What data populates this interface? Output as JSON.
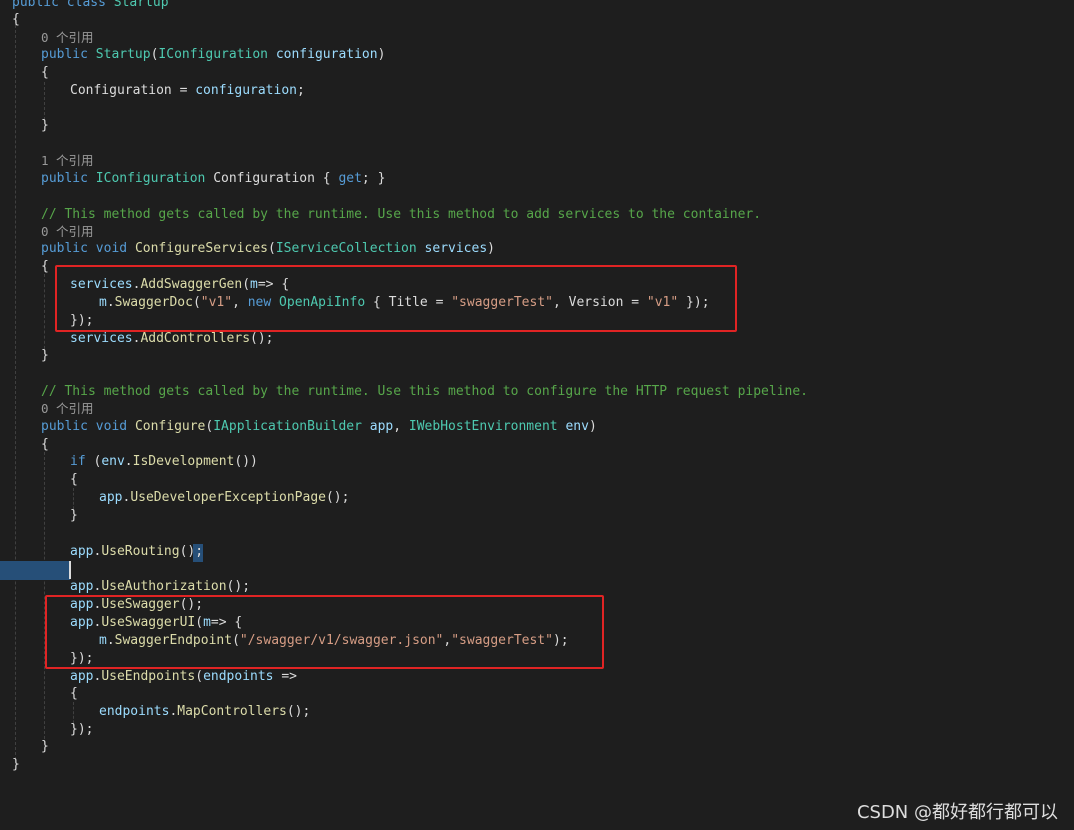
{
  "code": {
    "class_decl": [
      "public",
      " class ",
      "Startup"
    ],
    "open_brace_class": "{",
    "lens_ctor": "0 个引用",
    "ctor_line": [
      "public",
      " ",
      "Startup",
      "(",
      "IConfiguration",
      " ",
      "configuration",
      ")"
    ],
    "ctor_open": "{",
    "ctor_body": [
      "Configuration",
      " = ",
      "configuration",
      ";"
    ],
    "ctor_close": "}",
    "lens_prop": "1 个引用",
    "prop_line": [
      "public",
      " ",
      "IConfiguration",
      " Configuration { ",
      "get",
      "; }"
    ],
    "comment_1": "// This method gets called by the runtime. Use this method to add services to the container.",
    "lens_cs": "0 个引用",
    "cs_line": [
      "public",
      " ",
      "void",
      " ",
      "ConfigureServices",
      "(",
      "IServiceCollection",
      " ",
      "services",
      ")"
    ],
    "cs_open": "{",
    "cs_swag_1": [
      "services",
      ".",
      "AddSwaggerGen",
      "(",
      "m",
      "=> {"
    ],
    "cs_swag_2": [
      "m",
      ".",
      "SwaggerDoc",
      "(",
      "\"v1\"",
      ", ",
      "new",
      " ",
      "OpenApiInfo",
      " { Title = ",
      "\"swaggerTest\"",
      ", Version = ",
      "\"v1\"",
      " });"
    ],
    "cs_swag_3": "});",
    "cs_controllers": [
      "services",
      ".",
      "AddControllers",
      "();"
    ],
    "cs_close": "}",
    "comment_2": "// This method gets called by the runtime. Use this method to configure the HTTP request pipeline.",
    "lens_cfg": "0 个引用",
    "cfg_line": [
      "public",
      " ",
      "void",
      " ",
      "Configure",
      "(",
      "IApplicationBuilder",
      " ",
      "app",
      ", ",
      "IWebHostEnvironment",
      " ",
      "env",
      ")"
    ],
    "cfg_open": "{",
    "if_line": [
      "if",
      " (",
      "env",
      ".",
      "IsDevelopment",
      "())"
    ],
    "if_open": "{",
    "dev_page": [
      "app",
      ".",
      "UseDeveloperExceptionPage",
      "();"
    ],
    "if_close": "}",
    "use_routing": [
      "app",
      ".",
      "UseRouting",
      "();"
    ],
    "use_auth": [
      "app",
      ".",
      "UseAuthorization",
      "();"
    ],
    "use_swagger": [
      "app",
      ".",
      "UseSwagger",
      "();"
    ],
    "use_swagger_ui": [
      "app",
      ".",
      "UseSwaggerUI",
      "(",
      "m",
      "=> {"
    ],
    "swagger_endpoint": [
      "m",
      ".",
      "SwaggerEndpoint",
      "(",
      "\"/swagger/v1/swagger.json\"",
      ",",
      "\"swaggerTest\"",
      ");"
    ],
    "swagger_ui_close": "});",
    "use_endpoints": [
      "app",
      ".",
      "UseEndpoints",
      "(",
      "endpoints",
      " =>"
    ],
    "ep_open": "{",
    "map_controllers": [
      "endpoints",
      ".",
      "MapControllers",
      "();"
    ],
    "ep_close": "});",
    "cfg_close": "}",
    "class_close": "}"
  },
  "watermark": "CSDN @都好都行都可以",
  "colors": {
    "background": "#1e1e1e",
    "keyword": "#569cd6",
    "type": "#4ec9b0",
    "method": "#dcdcaa",
    "parameter": "#9cdcfe",
    "string": "#d69d85",
    "comment": "#57a64a",
    "highlight_box": "#e02424"
  }
}
